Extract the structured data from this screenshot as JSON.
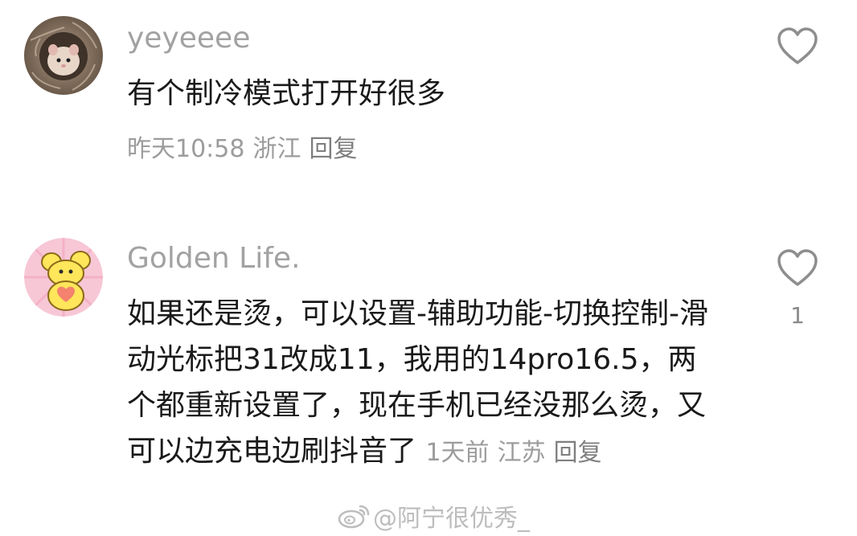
{
  "comments": [
    {
      "username": "yeyeeee",
      "text": "有个制冷模式打开好很多",
      "time": "昨天10:58",
      "location": "浙江",
      "reply_label": "回复",
      "like_count": "",
      "avatar_icon": "hamster-in-nest-photo"
    },
    {
      "username": "Golden Life.",
      "text": "如果还是烫，可以设置-辅助功能-切换控制-滑动光标把31改成11，我用的14pro16.5，两个都重新设置了，现在手机已经没那么烫，又可以边充电边刷抖音了",
      "time": "1天前",
      "location": "江苏",
      "reply_label": "回复",
      "like_count": "1",
      "avatar_icon": "cartoon-mouse-holding-heart"
    }
  ],
  "like_icon": "heart-outline-icon",
  "watermark": {
    "text": "@阿宁很优秀_",
    "icon": "weibo-logo-icon"
  },
  "colors": {
    "username": "#a2a2a2",
    "meta": "#9c9c9c",
    "body": "#1a1a1a",
    "heart_stroke": "#8e8e8e"
  }
}
